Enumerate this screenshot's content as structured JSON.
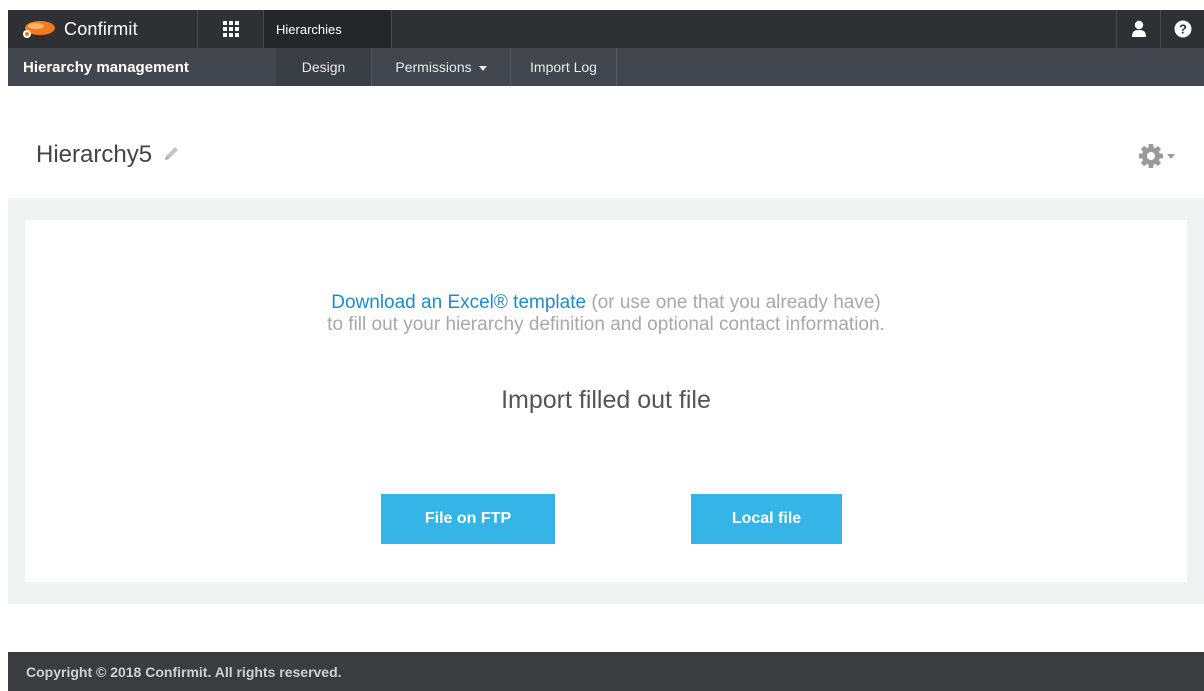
{
  "topbar": {
    "logo_text": "Confirmit",
    "app_tab": "Hierarchies",
    "icons": [
      "apps-grid-icon",
      "user-icon",
      "help-icon"
    ]
  },
  "navbar": {
    "title": "Hierarchy management",
    "tabs": [
      {
        "label": "Design",
        "active": true
      },
      {
        "label": "Permissions",
        "has_dropdown": true
      },
      {
        "label": "Import Log"
      }
    ]
  },
  "page": {
    "title": "Hierarchy5"
  },
  "import": {
    "link_text": "Download an Excel® template",
    "line1_rest": " (or use one that you already have)",
    "line2": "to fill out your hierarchy definition and optional contact information.",
    "title": "Import filled out file",
    "buttons": {
      "ftp": "File on FTP",
      "local": "Local file"
    }
  },
  "footer": {
    "copyright": "Copyright © 2018 Confirmit. All rights reserved."
  },
  "colors": {
    "topbar": "#2f3033",
    "navbar": "#42474f",
    "accent_button": "#35b4e8",
    "link": "#1d8cc7",
    "logo_orange": "#f47a20"
  }
}
